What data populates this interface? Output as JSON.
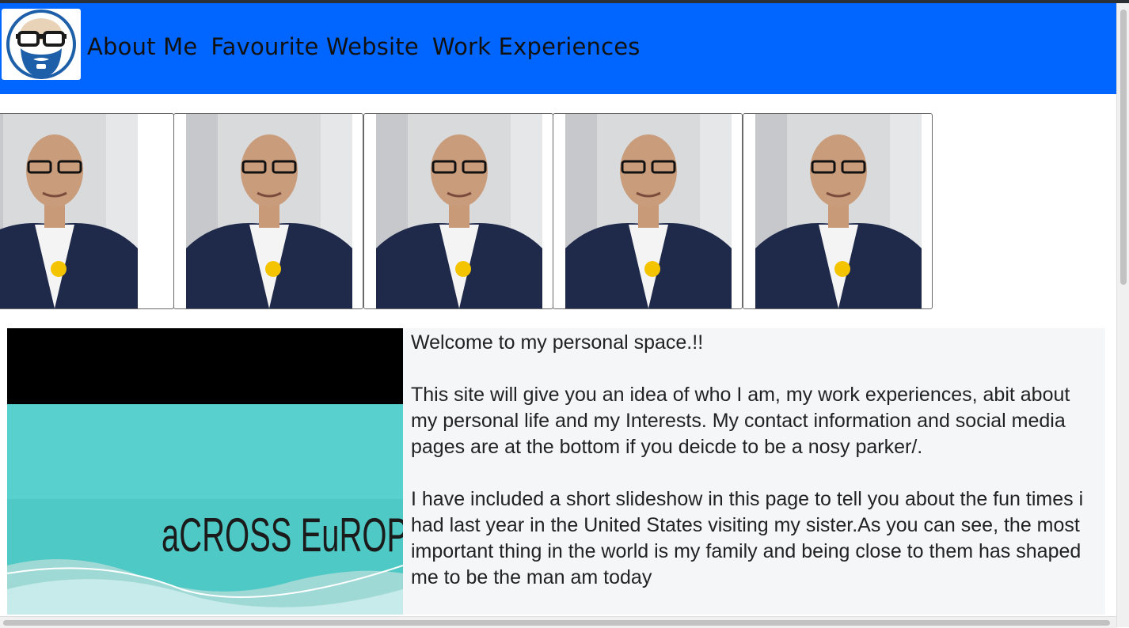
{
  "nav": {
    "logo_icon": "bearded-glasses-avatar-icon",
    "links": [
      "About Me",
      "Favourite Website",
      "Work Experiences"
    ]
  },
  "gallery": {
    "count": 5,
    "photo_icon": "profile-photo"
  },
  "video": {
    "title_text": "aCROSS EuROPE"
  },
  "intro": {
    "paragraphs": [
      "Welcome to my personal space.!!",
      "This site will give you an idea of who I am, my work experiences, abit about my personal life and my Interests. My contact information and social media pages are at the bottom if you deicde to be a nosy parker/.",
      "I have included a short slideshow in this page to tell you about the fun times i had last year in the United States visiting my sister.As you can see, the most important thing in the world is my family and being close to them has shaped me to be the man am today"
    ]
  },
  "colors": {
    "navbar": "#0066ff",
    "content_bg": "#f5f6f8"
  }
}
